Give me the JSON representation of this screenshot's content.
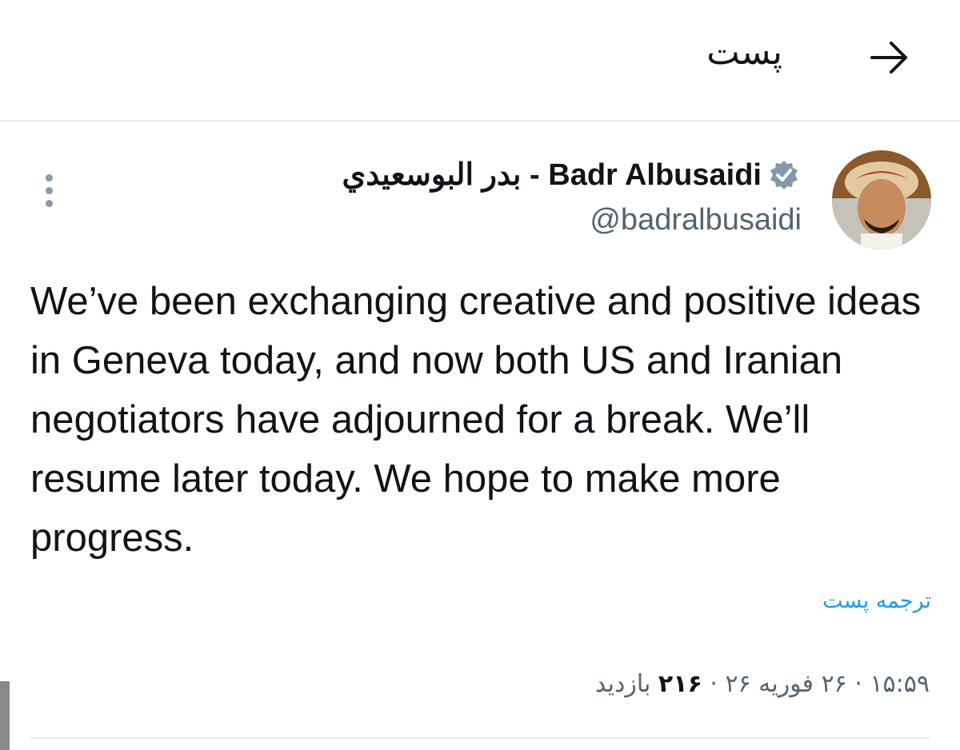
{
  "header": {
    "title": "پست",
    "back_icon": "arrow-right-icon"
  },
  "tweet": {
    "display_name": "Badr Albusaidi - بدر البوسعيدي",
    "handle": "@badralbusaidi",
    "verified_icon": "verified-badge-icon",
    "more_icon": "more-vertical-icon",
    "text": "We’ve been exchanging creative and positive ideas in Geneva today, and now both US and Iranian negotiators have adjourned for a break. We’ll resume later today. We hope to make more progress.",
    "translate_label": "ترجمه پست",
    "time": "۱۵:۵۹",
    "date": "۲۶ فوریه ۲۶",
    "views_count": "۲۱۶",
    "views_label": "بازدید",
    "separator": "·"
  },
  "colors": {
    "accent": "#1d9bf0",
    "text": "#0f1419",
    "secondary": "#536471",
    "divider": "#e7e9ea"
  }
}
